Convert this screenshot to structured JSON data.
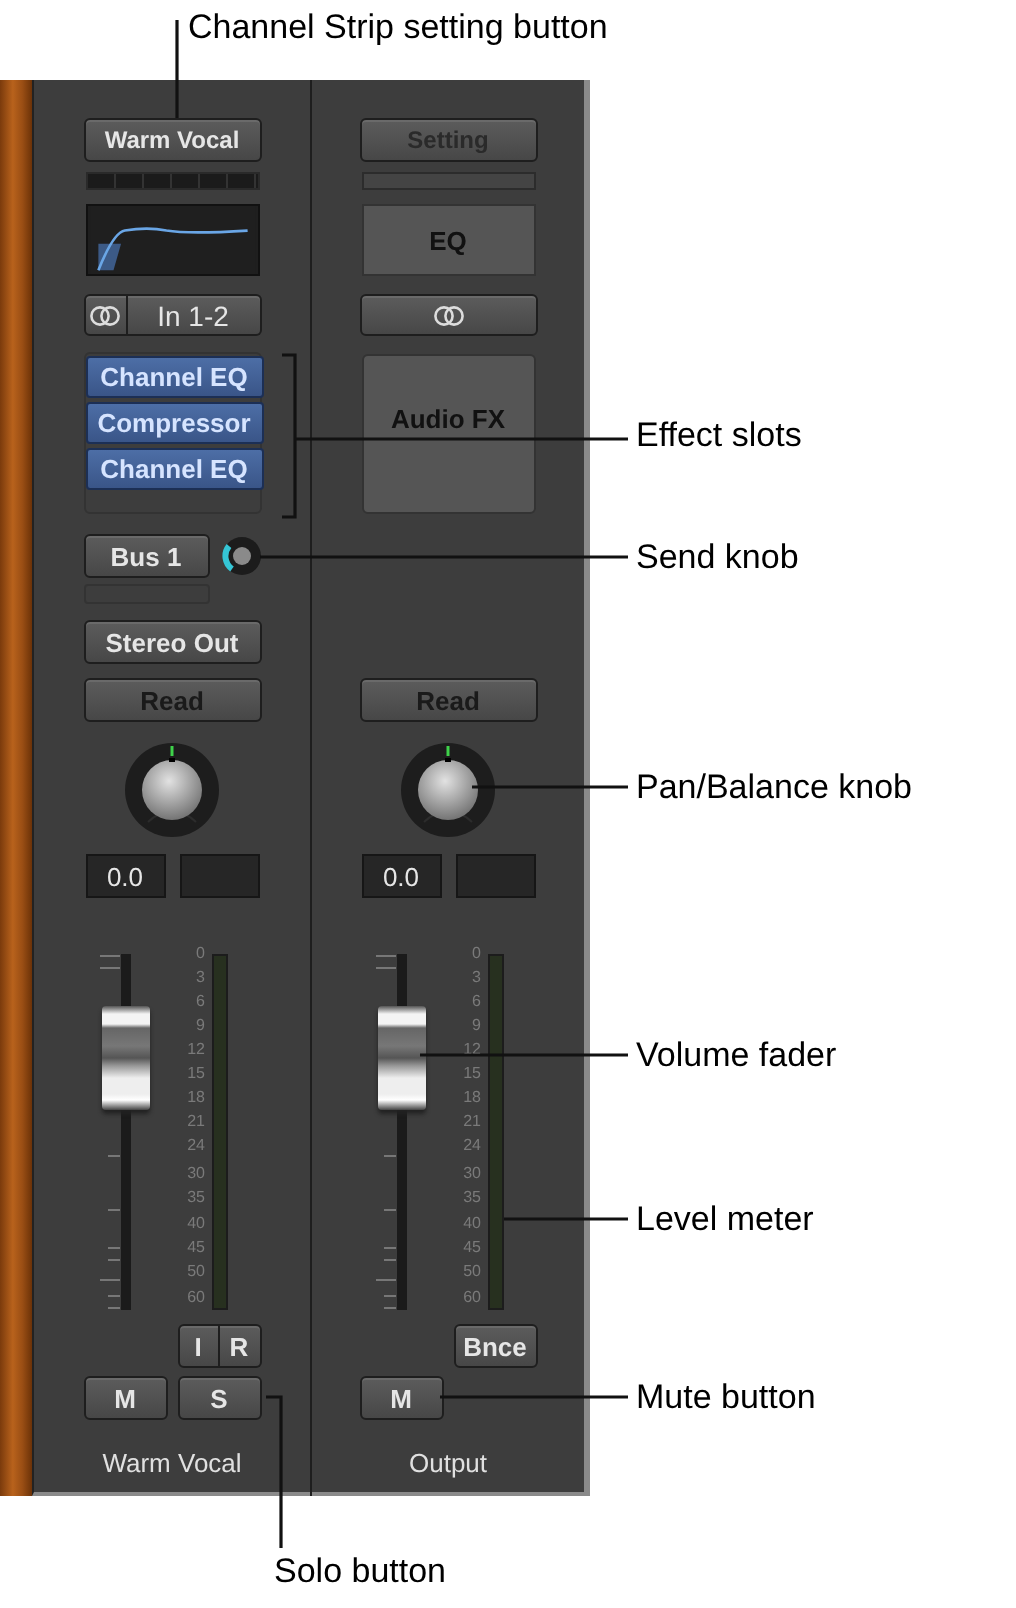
{
  "callouts": [
    {
      "label": "Channel Strip setting button"
    },
    {
      "label": "Effect slots"
    },
    {
      "label": "Send knob"
    },
    {
      "label": "Pan/Balance knob"
    },
    {
      "label": "Volume fader"
    },
    {
      "label": "Level meter"
    },
    {
      "label": "Mute button"
    },
    {
      "label": "Solo button"
    }
  ],
  "channels": [
    {
      "kind": "track",
      "setting": "Warm Vocal",
      "input": "In 1-2",
      "effects": [
        "Channel EQ",
        "Compressor",
        "Channel EQ"
      ],
      "send": "Bus 1",
      "output": "Stereo Out",
      "automation": "Read",
      "volume": "0.0",
      "fader": {
        "level": 0.71
      },
      "meter_scale": [
        "0",
        "3",
        "6",
        "9",
        "12",
        "15",
        "18",
        "21",
        "24",
        "30",
        "35",
        "40",
        "45",
        "50",
        "60"
      ],
      "io_buttons": [
        "I",
        "R"
      ],
      "mode_buttons": [
        "M",
        "S"
      ],
      "name": "Warm Vocal"
    },
    {
      "kind": "output",
      "setting": "Setting",
      "eq_label": "EQ",
      "effects_placeholder": "Audio FX",
      "automation": "Read",
      "volume": "0.0",
      "fader": {
        "level": 0.71
      },
      "meter_scale": [
        "0",
        "3",
        "6",
        "9",
        "12",
        "15",
        "18",
        "21",
        "24",
        "30",
        "35",
        "40",
        "45",
        "50",
        "60"
      ],
      "io_buttons": [
        "Bnce"
      ],
      "mode_buttons": [
        "M"
      ],
      "name": "Output"
    }
  ]
}
